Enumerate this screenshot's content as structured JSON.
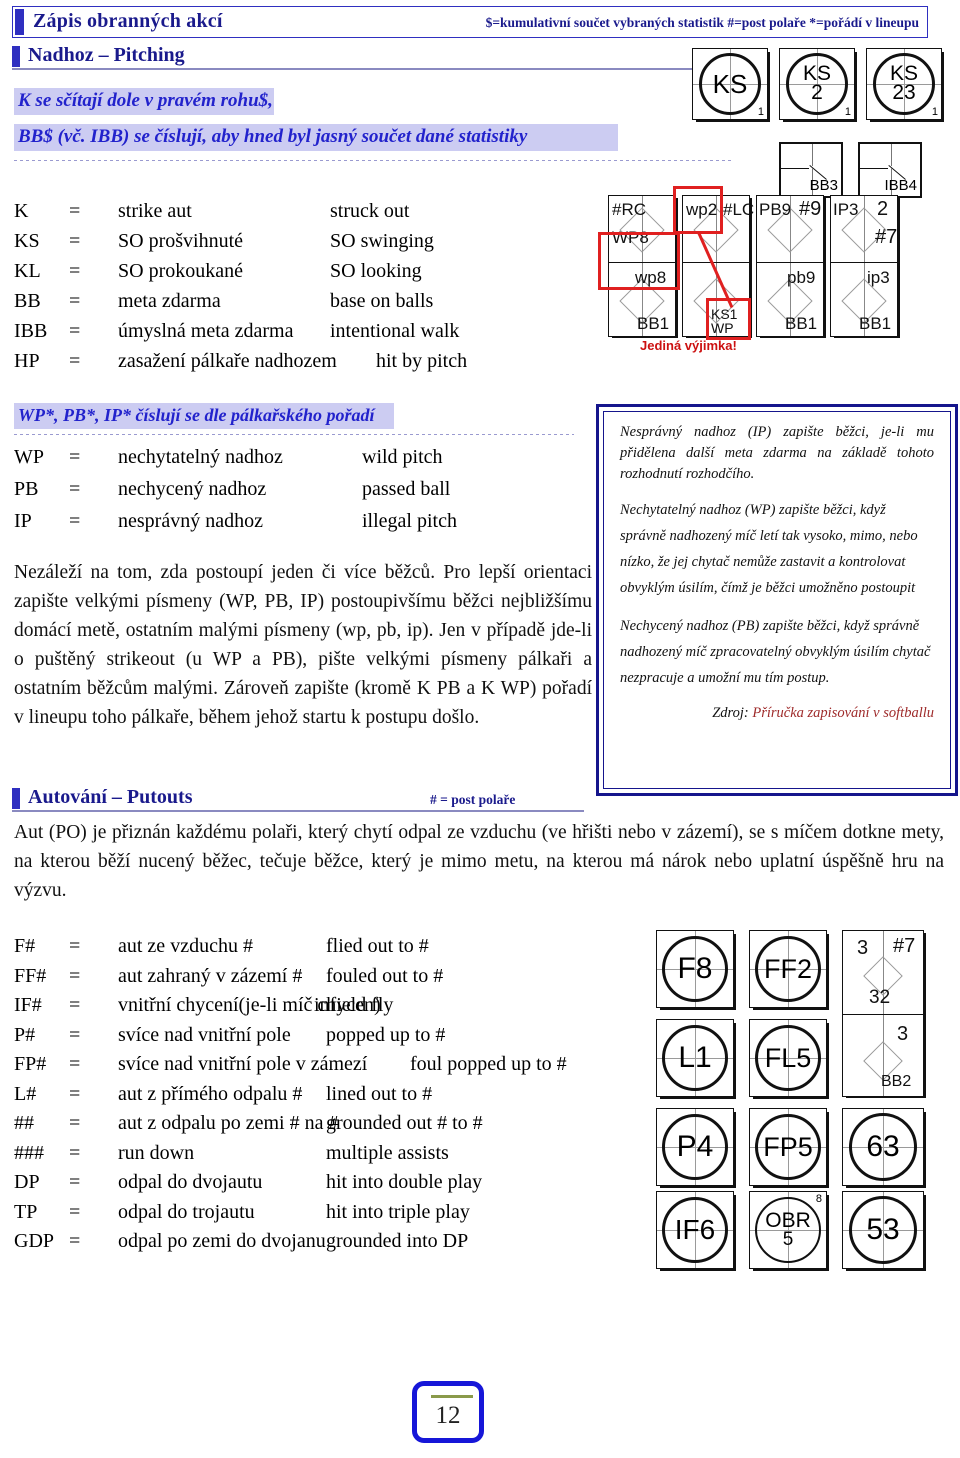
{
  "header": {
    "title": "Zápis obranných akcí",
    "legend": "$=kumulativní součet vybraných statistik  #=post polaře  *=pořádí v lineupu"
  },
  "sections": {
    "pitching": {
      "label": "Nadhoz – Pitching"
    },
    "putouts": {
      "label": "Autování – Putouts",
      "note": "# = post polaře"
    }
  },
  "highlights": {
    "line1": "K se sčítají dole v pravém rohu$,",
    "line2": "BB$ (vč. IBB) se číslují, aby hned byl jasný součet dané statistiky",
    "line3": "WP*, PB*, IP* číslují se dle pálkařského pořadí"
  },
  "pitching_table": [
    {
      "abbr": "K",
      "eq": "=",
      "cz": "strike aut",
      "en": "struck out"
    },
    {
      "abbr": "KS",
      "eq": "=",
      "cz": "SO prošvihnuté",
      "en": "SO swinging"
    },
    {
      "abbr": "KL",
      "eq": "=",
      "cz": "SO prokoukané",
      "en": "SO looking"
    },
    {
      "abbr": "BB",
      "eq": "=",
      "cz": "meta zdarma",
      "en": "base on balls"
    },
    {
      "abbr": "IBB",
      "eq": "=",
      "cz": "úmyslná meta zdarma",
      "en": "intentional walk"
    },
    {
      "abbr": "HP",
      "eq": "=",
      "cz": "zasažení pálkaře nadhozem",
      "en": "hit by pitch"
    }
  ],
  "wp_table": [
    {
      "abbr": "WP",
      "eq": "=",
      "cz": "nechytatelný nadhoz",
      "en": "wild pitch"
    },
    {
      "abbr": "PB",
      "eq": "=",
      "cz": "nechycený nadhoz",
      "en": "passed ball"
    },
    {
      "abbr": "IP",
      "eq": "=",
      "cz": "nesprávný nadhoz",
      "en": "illegal pitch"
    }
  ],
  "paragraphs": {
    "pitching_body": "Nezáleží na tom, zda postoupí jeden či více běžců. Pro lepší orientaci zapište velkými písmeny (WP, PB, IP) postoupivšímu běžci nejbližšímu domácí metě, ostatním malými písmeny (wp, pb, ip). Jen v případě jde-li o puštěný strikeout (u WP a PB), pište velkými písmeny pálkaři a ostatním běžcům malými. Zároveň zapište (kromě K PB a K WP) pořadí v lineupu toho pálkaře, během jehož startu k postupu došlo.",
    "putouts_body": "Aut (PO) je přiznán každému polaři, který chytí odpal ze vzduchu (ve hřišti nebo v zázemí), se s míčem dotkne mety, na kterou běží nucený běžec, tečuje běžce, který je mimo metu, na kterou má nárok nebo uplatní úspěšně hru na výzvu."
  },
  "notebox": {
    "p1": "Nesprávný nadhoz (IP) zapište běžci, je-li mu přidělena další meta zdarma na základě tohoto rozhodnutí rozhodčího.",
    "p2": "Nechytatelný nadhoz (WP) zapište běžci, když správně nadhozený míč letí tak vysoko, mimo, nebo nízko, že jej chytač nemůže zastavit a kontrolovat obvyklým úsilím, čímž je běžci umožněno postoupit",
    "p3": "Nechycený nadhoz (PB) zapište běžci, když správně nadhozený míč zpracovatelný obvyklým úsilím chytač nezpracuje a umožní mu tím postup.",
    "source_label": "Zdroj:",
    "source_value": "Příručka zapisování v softballu"
  },
  "putouts_table": [
    {
      "abbr": "F#",
      "eq": "=",
      "cz": "aut ze vzduchu #",
      "en": "flied out to #"
    },
    {
      "abbr": "FF#",
      "eq": "=",
      "cz": "aut zahraný v zázemí #",
      "en": "fouled out to #"
    },
    {
      "abbr": "IF#",
      "eq": "=",
      "cz": "vnitřní chycení(je-li míč chycen)",
      "en": "infield fly"
    },
    {
      "abbr": "P#",
      "eq": "=",
      "cz": "svíce nad vnitřní pole",
      "en": "popped up to #"
    },
    {
      "abbr": "FP#",
      "eq": "=",
      "cz": "svíce nad vnitřní pole v zámezí",
      "en": "foul popped up to #"
    },
    {
      "abbr": "L#",
      "eq": "=",
      "cz": "aut z přímého odpalu #",
      "en": "lined out to #"
    },
    {
      "abbr": "##",
      "eq": "=",
      "cz": "aut z odpalu po zemi # na #",
      "en": "grounded out # to #"
    },
    {
      "abbr": "###",
      "eq": "=",
      "cz": "run down",
      "en": "multiple assists"
    },
    {
      "abbr": "DP",
      "eq": "=",
      "cz": "odpal do dvojautu",
      "en": "hit into double play"
    },
    {
      "abbr": "TP",
      "eq": "=",
      "cz": "odpal do trojautu",
      "en": "hit into triple play"
    },
    {
      "abbr": "GDP",
      "eq": "=",
      "cz": "odpal po zemi do dvojanu",
      "en": "grounded into DP"
    }
  ],
  "diagram_top": {
    "cells": [
      {
        "main": "KS",
        "sub": "",
        "corner": "1"
      },
      {
        "main": "KS",
        "sub": "2",
        "corner": "1"
      },
      {
        "main": "KS",
        "sub": "23",
        "corner": "1"
      }
    ]
  },
  "diagram_walks": [
    {
      "label": "BB3"
    },
    {
      "label": "IBB4"
    }
  ],
  "diagram_pitch": {
    "caption": "Jediná výjimka!",
    "cells": [
      {
        "tl": "#RC",
        "ml": "WP8",
        "mr": "wp8",
        "br": "BB1"
      },
      {
        "tl": "wp2",
        "tr": "#LC",
        "br": "KS1",
        "br2": "WP"
      },
      {
        "tl": "PB9",
        "tr": "#9",
        "mr": "pb9",
        "br": "BB1"
      },
      {
        "tl": "IP3",
        "tr": "2",
        "tr2": "#7",
        "mr": "ip3",
        "br": "BB1"
      }
    ]
  },
  "diagram_bottom": {
    "cells": [
      {
        "main": "F8",
        "sub": "",
        "corner": ""
      },
      {
        "main": "FF2",
        "sub": "",
        "corner": ""
      },
      {
        "main": "L1",
        "sub": "",
        "corner": ""
      },
      {
        "main": "FL5",
        "sub": "",
        "corner": ""
      },
      {
        "main": "P4",
        "sub": "",
        "corner": ""
      },
      {
        "main": "FP5",
        "sub": "",
        "corner": ""
      },
      {
        "main": "IF6",
        "sub": "",
        "corner": ""
      },
      {
        "main": "OBR",
        "sub": "5",
        "corner": "8"
      }
    ],
    "play_cell": {
      "t1": "3",
      "t2": "#7",
      "circle": "32",
      "m1": "3",
      "b1": "BB2"
    },
    "right_cells": [
      {
        "main": "63"
      },
      {
        "main": "53"
      }
    ]
  },
  "page_number": "12",
  "colors": {
    "brand_blue": "#1a1a8c",
    "accent_blue": "#2f2fc0",
    "highlight": "#ccccf2",
    "red": "#e02020",
    "source_red": "#9e2a2a"
  }
}
